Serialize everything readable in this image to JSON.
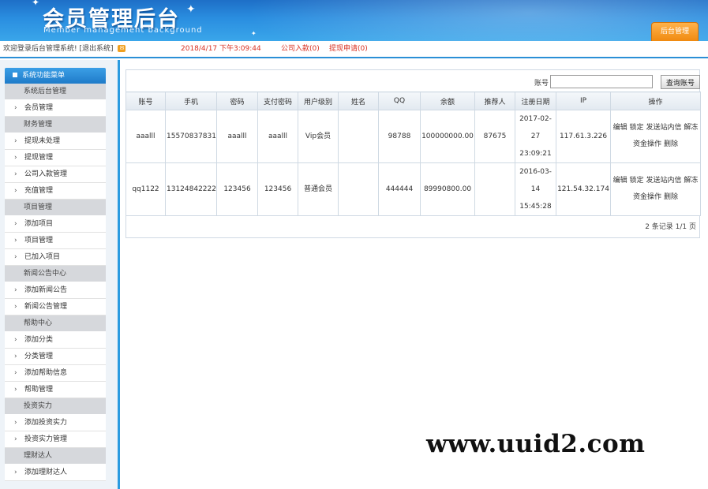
{
  "header": {
    "title": "会员管理后台",
    "subtitle": "Member management background",
    "admin_tab": "后台管理"
  },
  "statusbar": {
    "welcome": "欢迎登录后台管理系统!",
    "logout": "[退出系统]",
    "datetime": "2018/4/17 下午3:09:44",
    "company_deposit": "公司入款(0)",
    "withdraw_apply": "提现申请(0)"
  },
  "sidebar": {
    "heading": "系统功能菜单",
    "items": [
      {
        "type": "group",
        "label": "系统后台管理"
      },
      {
        "type": "item",
        "label": "会员管理"
      },
      {
        "type": "group",
        "label": "财务管理"
      },
      {
        "type": "item",
        "label": "提现未处理"
      },
      {
        "type": "item",
        "label": "提现管理"
      },
      {
        "type": "item",
        "label": "公司入款管理"
      },
      {
        "type": "item",
        "label": "充值管理"
      },
      {
        "type": "group",
        "label": "项目管理"
      },
      {
        "type": "item",
        "label": "添加项目"
      },
      {
        "type": "item",
        "label": "项目管理"
      },
      {
        "type": "item",
        "label": "已加入项目"
      },
      {
        "type": "group",
        "label": "新闻公告中心"
      },
      {
        "type": "item",
        "label": "添加新闻公告"
      },
      {
        "type": "item",
        "label": "新闻公告管理"
      },
      {
        "type": "group",
        "label": "帮助中心"
      },
      {
        "type": "item",
        "label": "添加分类"
      },
      {
        "type": "item",
        "label": "分类管理"
      },
      {
        "type": "item",
        "label": "添加帮助信息"
      },
      {
        "type": "item",
        "label": "帮助管理"
      },
      {
        "type": "group",
        "label": "投资实力"
      },
      {
        "type": "item",
        "label": "添加投资实力"
      },
      {
        "type": "item",
        "label": "投资实力管理"
      },
      {
        "type": "group",
        "label": "理财达人"
      },
      {
        "type": "item",
        "label": "添加理财达人"
      }
    ]
  },
  "search": {
    "label": "账号",
    "value": "",
    "button": "查询账号"
  },
  "table": {
    "columns": [
      "账号",
      "手机",
      "密码",
      "支付密码",
      "用户级别",
      "姓名",
      "QQ",
      "余额",
      "推荐人",
      "注册日期",
      "IP",
      "操作"
    ],
    "rows": [
      {
        "account": "aaalll",
        "phone": "15570837831",
        "password": "aaalll",
        "pay_password": "aaalll",
        "level": "Vip会员",
        "name": "",
        "qq": "98788",
        "balance": "100000000.00",
        "referrer": "87675",
        "reg_date_lines": [
          "2017-02-",
          "27",
          "23:09:21"
        ],
        "ip": "117.61.3.226",
        "ops": {
          "edit": "编辑",
          "lock": "锁定",
          "message": "发送站内信",
          "unfreeze": "解冻",
          "funds": "资金操作",
          "delete": "删除"
        }
      },
      {
        "account": "qq1122",
        "phone": "13124842222",
        "password": "123456",
        "pay_password": "123456",
        "level": "普通会员",
        "name": "",
        "qq": "444444",
        "balance": "89990800.00",
        "referrer": "",
        "reg_date_lines": [
          "2016-03-",
          "14",
          "15:45:28"
        ],
        "ip": "121.54.32.174",
        "ops": {
          "edit": "编辑",
          "lock": "锁定",
          "message": "发送站内信",
          "unfreeze": "解冻",
          "funds": "资金操作",
          "delete": "删除"
        }
      }
    ]
  },
  "pager": {
    "text": "2 条记录 1/1 页"
  },
  "watermark": "www.uuid2.com",
  "colors": {
    "header_blue": "#2a8ee0",
    "accent_orange": "#f08a10",
    "status_red": "#d93020"
  }
}
